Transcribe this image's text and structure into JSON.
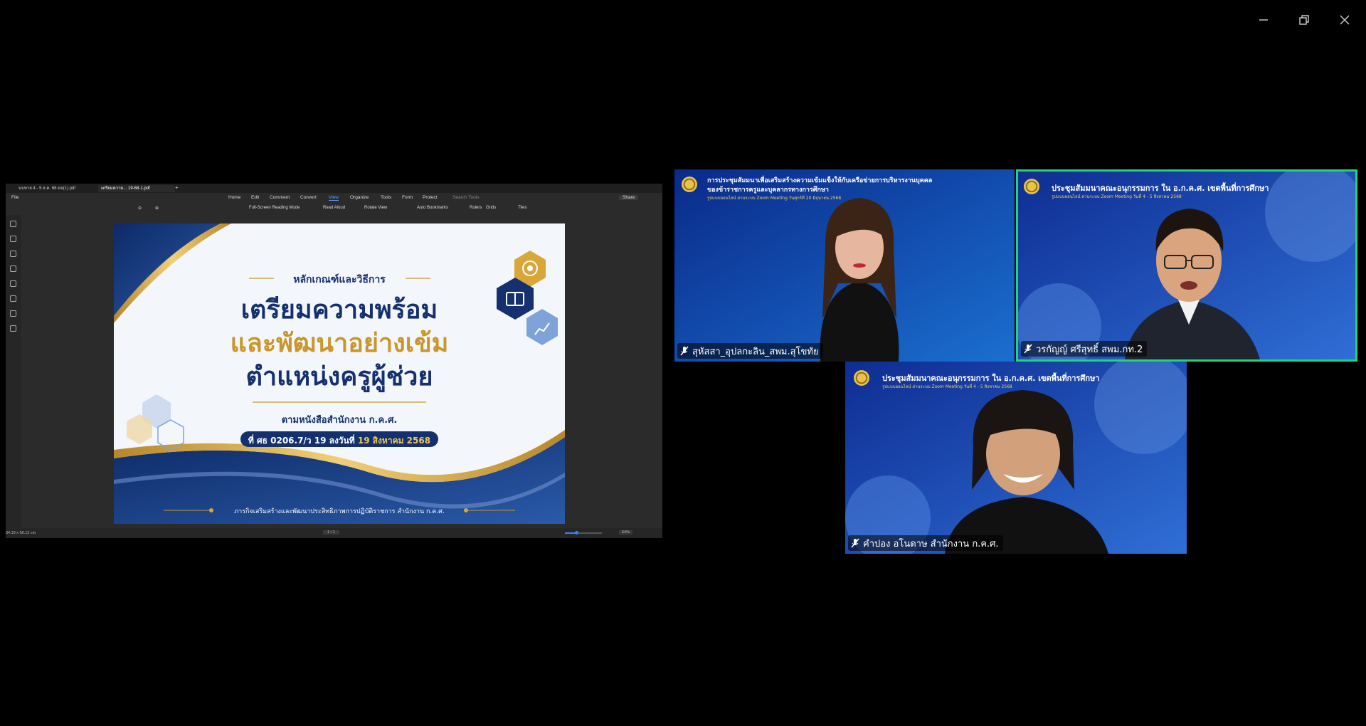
{
  "window": {
    "controls": [
      "minimize-icon",
      "restore-icon",
      "close-icon"
    ]
  },
  "shared_screen": {
    "tabs": [
      "นบทาย 4 - 5 ส.ค. 68 ตล(1).pdf",
      "เตรียมความ... 19-68-1.pdf"
    ],
    "menu": [
      "File",
      "Home",
      "Edit",
      "Comment",
      "Convert",
      "View",
      "Organize",
      "Tools",
      "Form",
      "Protect"
    ],
    "active_menu": "View",
    "search_placeholder": "Search Tools",
    "share_label": "Share",
    "toolbar": [
      "Full-Screen Reading Mode",
      "Read Aloud",
      "Rotate View",
      "Auto Bookmarks",
      "Rulers",
      "Grids",
      "Tiles"
    ],
    "status_size": "34.19 x 56.12 cm",
    "page_indicator": "1 / 1",
    "zoom": "64%",
    "slide": {
      "kicker": "หลักเกณฑ์และวิธีการ",
      "line1": "เตรียมความพร้อม",
      "line2": "และพัฒนาอย่างเข้ม",
      "line3": "ตำแหน่งครูผู้ช่วย",
      "reference": "ตามหนังสือสำนักงาน ก.ค.ศ.",
      "doc_number": "ที่ ศธ 0206.7/ว 19 ลงวันที่",
      "doc_date": "19 สิงหาคม 2568",
      "footer": "ภารกิจเสริมสร้างและพัฒนาประสิทธิภาพการปฏิบัติราชการ สำนักงาน ก.ค.ศ.",
      "colors": {
        "navy": "#14306e",
        "gold": "#c9962a"
      }
    }
  },
  "participants": [
    {
      "name": "สุหัสสา_อุปลกะลิน_สพม.สุโขทัย",
      "banner_title_1": "การประชุมสัมมนาเพื่อเสริมสร้างความเข้มแข็งให้กับเครือข่ายการบริหารงานบุคคล",
      "banner_title_2": "ของข้าราชการครูและบุคลากรทางการศึกษา",
      "banner_sub": "รูปแบบออนไลน์ ผ่านระบบ Zoom Meeting วันศุกร์ที่ 20 มิถุนายน 2568",
      "active_speaker": false
    },
    {
      "name": "วรกัญญ์ ศรีสุทธิ์ สพม.กท.2",
      "banner_title_1": "ประชุมสัมมนาคณะอนุกรรมการ ใน อ.ก.ค.ศ. เขตพื้นที่การศึกษา",
      "banner_sub": "รูปแบบออนไลน์ ผ่านระบบ Zoom Meeting วันที่ 4 - 5 สิงหาคม 2568",
      "active_speaker": true
    },
    {
      "name": "คำปอง อโนดาษ สำนักงาน ก.ค.ศ.",
      "banner_title_1": "ประชุมสัมมนาคณะอนุกรรมการ ใน อ.ก.ค.ศ. เขตพื้นที่การศึกษา",
      "banner_sub": "รูปแบบออนไลน์ ผ่านระบบ Zoom Meeting วันที่ 4 - 5 สิงหาคม 2568",
      "active_speaker": false
    }
  ],
  "colors": {
    "active_border": "#22d47a",
    "tile_bg": "#14308c"
  }
}
